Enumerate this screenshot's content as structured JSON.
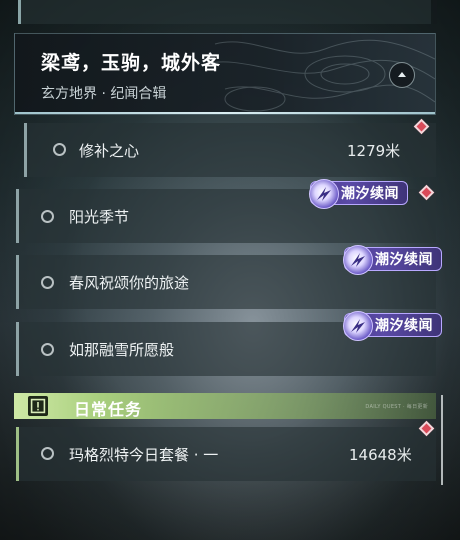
{
  "header": {
    "title": "梁鸢，玉驹，城外客",
    "subtitle": "玄方地界 · 纪闻合辑"
  },
  "quests": [
    {
      "label": "修补之心",
      "distance": "1279米",
      "marker": true,
      "tag": ""
    },
    {
      "label": "阳光季节",
      "distance": "",
      "marker": true,
      "tag": "潮汐续闻"
    },
    {
      "label": "春风祝颂你的旅途",
      "distance": "",
      "marker": false,
      "tag": "潮汐续闻"
    },
    {
      "label": "如那融雪所愿般",
      "distance": "",
      "marker": false,
      "tag": "潮汐续闻"
    }
  ],
  "daily": {
    "title": "日常任务",
    "subtitle": "DAILY QUEST · 每日更新",
    "icon": "exclamation-icon",
    "items": [
      {
        "label": "玛格烈特今日套餐 · 一",
        "distance": "14648米",
        "marker": true
      }
    ]
  },
  "colors": {
    "tag_purple": "#5a4aa6",
    "marker_red": "#d94a59",
    "daily_green": "#a9cf7e"
  }
}
